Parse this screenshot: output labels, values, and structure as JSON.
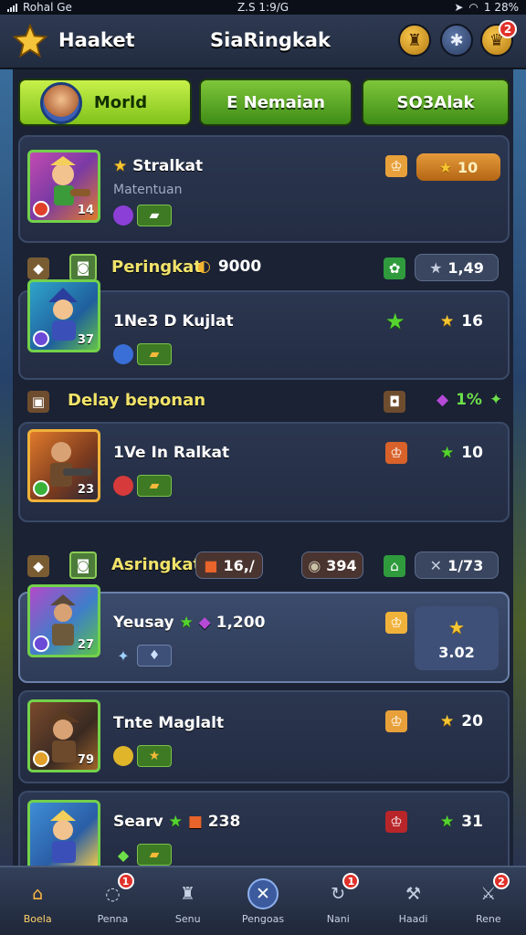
{
  "status_bar": {
    "carrier": "Rohal Ge",
    "time": "Z.S 1:9/G",
    "battery": "1 28%"
  },
  "header": {
    "title": "Haaket",
    "center_title": "SiaRingkak",
    "header_badge": "2"
  },
  "tabs": [
    {
      "label": "Morld",
      "active": true
    },
    {
      "label": "E Nemaian",
      "active": false
    },
    {
      "label": "SO3Alak",
      "active": false
    }
  ],
  "cards": {
    "c1": {
      "name": "Stralkat",
      "sub": "Matentuan",
      "level": "14",
      "pill": "10"
    },
    "s1": {
      "label": "Peringkat",
      "value": "9000",
      "pill": "1,49"
    },
    "c2": {
      "name": "1Ne3 D Kujlat",
      "level": "37",
      "score": "16"
    },
    "s2": {
      "label": "Delay beponan",
      "value": "1%"
    },
    "c3": {
      "name": "1Ve In Ralkat",
      "level": "23",
      "score": "10"
    },
    "s3": {
      "label": "Asringkat",
      "pill1": "16,/",
      "pill2": "394",
      "pill3": "1/73"
    },
    "c4": {
      "name": "Yeusay",
      "value": "1,200",
      "level": "27",
      "box": "3.02"
    },
    "c5": {
      "name": "Tnte Maglalt",
      "level": "79",
      "score": "20"
    },
    "c6": {
      "name": "Searv",
      "value": "238",
      "score": "31"
    }
  },
  "bottom_nav": [
    {
      "label": "Boela",
      "active": true,
      "badge": ""
    },
    {
      "label": "Penna",
      "active": false,
      "badge": "1"
    },
    {
      "label": "Senu",
      "active": false,
      "badge": ""
    },
    {
      "label": "Pengoas",
      "active": false,
      "badge": ""
    },
    {
      "label": "Nani",
      "active": false,
      "badge": "1"
    },
    {
      "label": "Haadi",
      "active": false,
      "badge": ""
    },
    {
      "label": "Rene",
      "active": false,
      "badge": "2"
    }
  ]
}
